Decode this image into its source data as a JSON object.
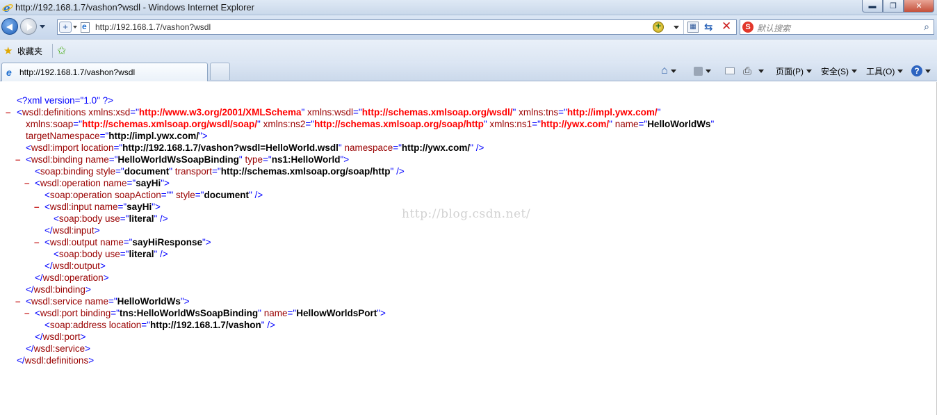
{
  "window": {
    "title": "http://192.168.1.7/vashon?wsdl - Windows Internet Explorer"
  },
  "address_bar": {
    "url": "http://192.168.1.7/vashon?wsdl"
  },
  "search": {
    "placeholder": "默认搜索"
  },
  "favorites": {
    "label": "收藏夹"
  },
  "tab": {
    "label": "http://192.168.1.7/vashon?wsdl"
  },
  "command_bar": {
    "page": "页面(P)",
    "safety": "安全(S)",
    "tools": "工具(O)"
  },
  "watermark": "http://blog.csdn.net/",
  "xml": {
    "pi": "<?xml version=\"1.0\" ?>",
    "definitions": {
      "xsd": "http://www.w3.org/2001/XMLSchema",
      "wsdl": "http://schemas.xmlsoap.org/wsdl/",
      "tns": "http://impl.ywx.com/",
      "soap": "http://schemas.xmlsoap.org/wsdl/soap/",
      "ns2": "http://schemas.xmlsoap.org/soap/http",
      "ns1": "http://ywx.com/",
      "name": "HelloWorldWs",
      "targetNamespace": "http://impl.ywx.com/"
    },
    "import": {
      "location": "http://192.168.1.7/vashon?wsdl=HelloWorld.wsdl",
      "namespace": "http://ywx.com/"
    },
    "binding": {
      "name": "HelloWorldWsSoapBinding",
      "type": "ns1:HelloWorld",
      "style": "document",
      "transport": "http://schemas.xmlsoap.org/soap/http"
    },
    "operation": {
      "name": "sayHi",
      "soapAction": "",
      "style": "document",
      "input_name": "sayHi",
      "input_use": "literal",
      "output_name": "sayHiResponse",
      "output_use": "literal"
    },
    "service": {
      "name": "HelloWorldWs",
      "port_binding": "tns:HelloWorldWsSoapBinding",
      "port_name": "HellowWorldsPort",
      "address": "http://192.168.1.7/vashon"
    }
  }
}
